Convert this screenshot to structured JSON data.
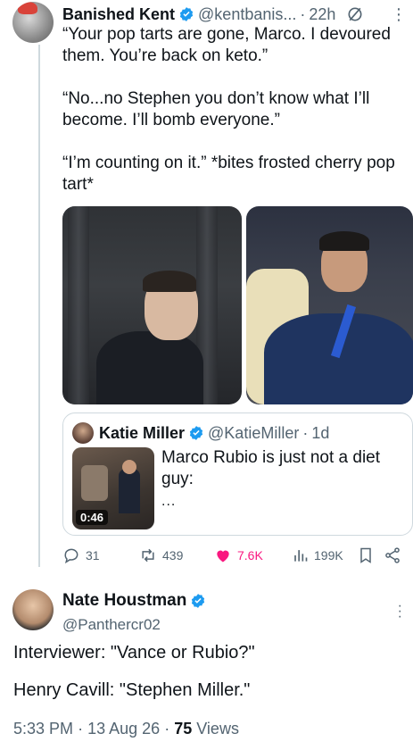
{
  "tweet1": {
    "author_name": "Banished Kent",
    "handle": "@kentbanis...",
    "separator": "·",
    "time": "22h",
    "paragraphs": [
      "“Your pop tarts are gone, Marco. I devoured them. You’re back on keto.”",
      "“No...no Stephen you don’t know what I’ll become. I’ll bomb everyone.”",
      "“I’m counting on it.” *bites frosted cherry pop tart*"
    ],
    "quote": {
      "author_name": "Katie Miller",
      "handle": "@KatieMiller",
      "separator": "·",
      "time": "1d",
      "text": "Marco Rubio is just not a diet guy:",
      "ellipsis": "...",
      "video_duration": "0:46"
    },
    "actions": {
      "replies": "31",
      "reposts": "439",
      "likes": "7.6K",
      "views": "199K"
    }
  },
  "tweet2": {
    "author_name": "Nate Houstman",
    "handle": "@Panthercr02",
    "lines": [
      "Interviewer: \"Vance or Rubio?\"",
      "Henry Cavill: \"Stephen Miller.\""
    ],
    "time": "5:33 PM",
    "date": "13 Aug 26",
    "views_count": "75",
    "views_label": "Views",
    "meta_sep": "·"
  },
  "colors": {
    "verified": "#1d9bf0",
    "like": "#f91880",
    "secondary_text": "#536471",
    "border": "#cfd9de"
  },
  "icons": [
    "grok-icon",
    "more-icon",
    "reply-icon",
    "repost-icon",
    "heart-icon",
    "views-icon",
    "bookmark-icon",
    "share-icon",
    "verified-icon"
  ]
}
